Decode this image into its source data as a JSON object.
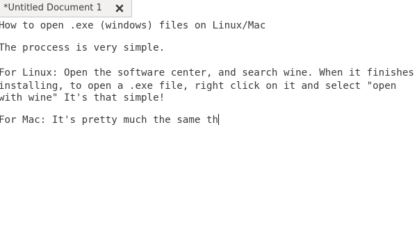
{
  "tab": {
    "title": "*Untitled Document 1"
  },
  "icons": {
    "close": "close-icon"
  },
  "document": {
    "lines": [
      "How to open .exe (windows) files on Linux/Mac",
      "",
      "The proccess is very simple.",
      "",
      "For Linux: Open the software center, and search wine. When it finishes",
      "installing, to open a .exe file, right click on it and select \"open",
      "with wine\" It's that simple!",
      "",
      "For Mac: It's pretty much the same th"
    ]
  }
}
